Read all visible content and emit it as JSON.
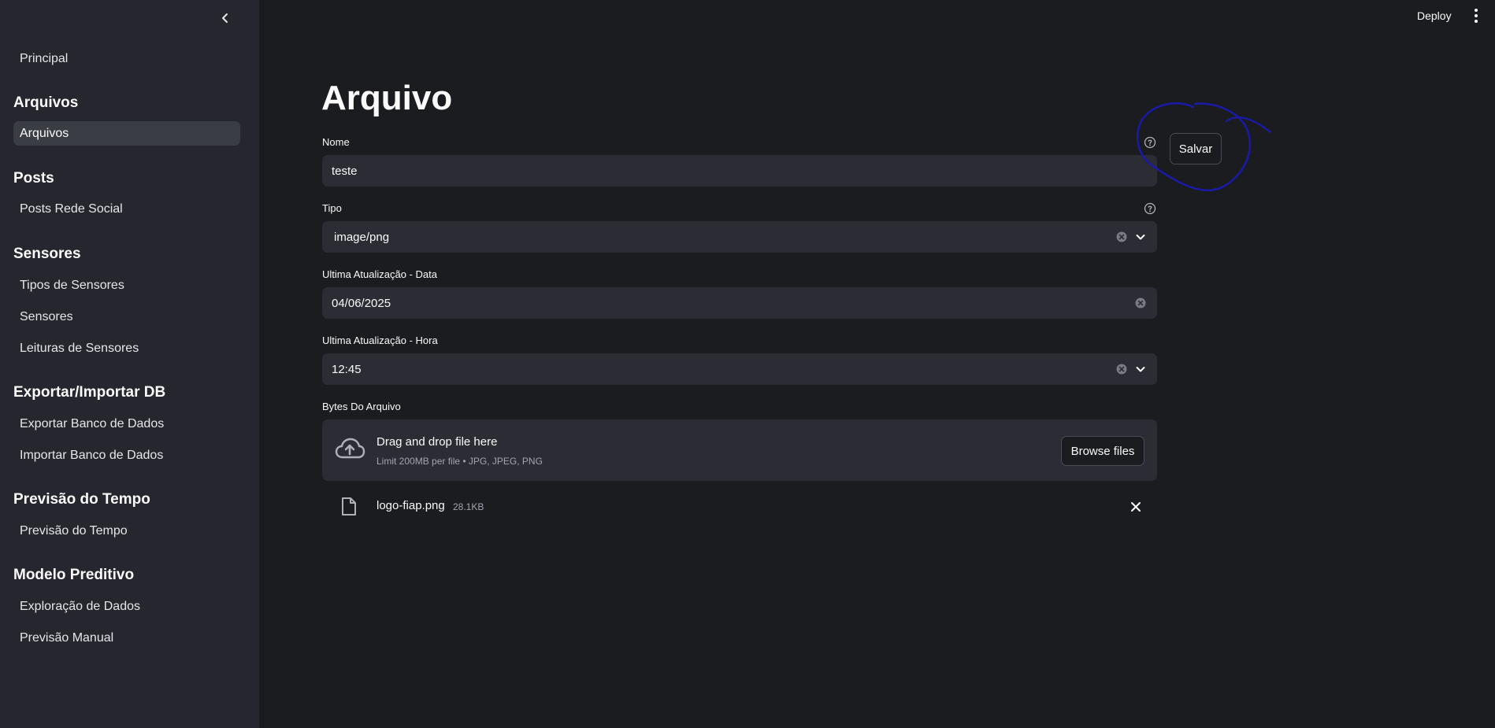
{
  "sidebar": {
    "top_item": "Principal",
    "sections": [
      {
        "title": "Arquivos",
        "items": [
          "Arquivos"
        ]
      },
      {
        "title": "Posts",
        "items": [
          "Posts Rede Social"
        ]
      },
      {
        "title": "Sensores",
        "items": [
          "Tipos de Sensores",
          "Sensores",
          "Leituras de Sensores"
        ]
      },
      {
        "title": "Exportar/Importar DB",
        "items": [
          "Exportar Banco de Dados",
          "Importar Banco de Dados"
        ]
      },
      {
        "title": "Previsão do Tempo",
        "items": [
          "Previsão do Tempo"
        ]
      },
      {
        "title": "Modelo Preditivo",
        "items": [
          "Exploração de Dados",
          "Previsão Manual"
        ]
      }
    ],
    "active_item": "Arquivos"
  },
  "topbar": {
    "deploy_label": "Deploy"
  },
  "main": {
    "title": "Arquivo",
    "nome": {
      "label": "Nome",
      "value": "teste"
    },
    "tipo": {
      "label": "Tipo",
      "value": "image/png"
    },
    "data": {
      "label": "Ultima Atualização - Data",
      "value": "04/06/2025"
    },
    "hora": {
      "label": "Ultima Atualização - Hora",
      "value": "12:45"
    },
    "bytes": {
      "label": "Bytes Do Arquivo",
      "drop_title": "Drag and drop file here",
      "drop_limit": "Limit 200MB per file • JPG, JPEG, PNG",
      "browse_label": "Browse files",
      "file_name": "logo-fiap.png",
      "file_size": "28.1KB"
    },
    "save_label": "Salvar"
  },
  "colors": {
    "background": "#1b1c20",
    "sidebar": "#26272e",
    "input": "#2b2c34",
    "annotation": "#1a1aa8"
  },
  "icons": [
    "chevron-left-icon",
    "kebab-menu-icon",
    "help-icon",
    "clear-icon",
    "chevron-down-icon",
    "cloud-upload-icon",
    "file-icon",
    "close-icon"
  ]
}
